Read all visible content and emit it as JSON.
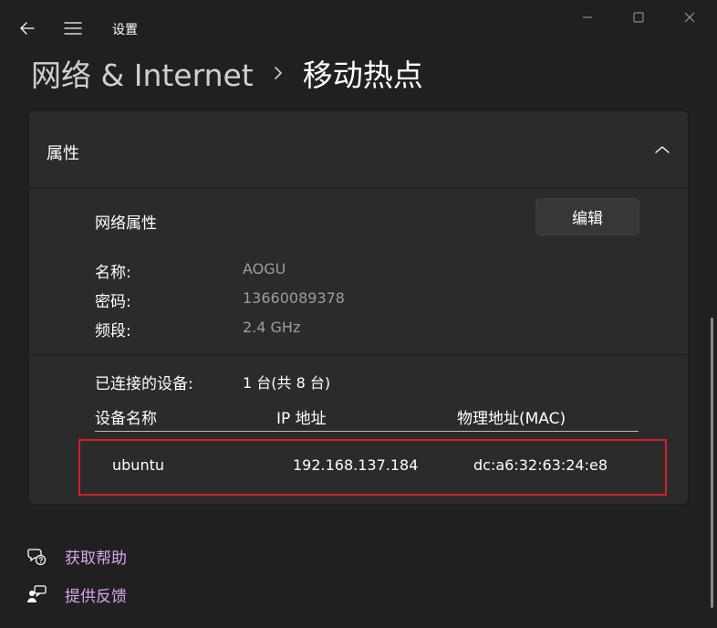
{
  "titlebar": {
    "app_title": "设置",
    "back_icon": "back-arrow-icon",
    "menu_icon": "hamburger-menu-icon"
  },
  "breadcrumb": {
    "parent": "网络 & Internet",
    "current": "移动热点"
  },
  "properties": {
    "title": "属性",
    "network_section_label": "网络属性",
    "edit_button": "编辑",
    "fields": [
      {
        "label": "名称:",
        "value": "AOGU"
      },
      {
        "label": "密码:",
        "value": "13660089378"
      },
      {
        "label": "频段:",
        "value": "2.4 GHz"
      }
    ],
    "connected_label": "已连接的设备:",
    "connected_value": "1 台(共 8 台)",
    "table": {
      "columns": [
        "设备名称",
        "IP 地址",
        "物理地址(MAC)"
      ],
      "rows": [
        {
          "name": "ubuntu",
          "ip": "192.168.137.184",
          "mac": "dc:a6:32:63:24:e8"
        }
      ]
    }
  },
  "footer": {
    "help_label": "获取帮助",
    "feedback_label": "提供反馈"
  },
  "colors": {
    "background": "#202020",
    "card": "#2b2b2b",
    "link": "#d7a5ec",
    "highlight_border": "#d0212a",
    "muted_text": "#9d9d9d"
  }
}
